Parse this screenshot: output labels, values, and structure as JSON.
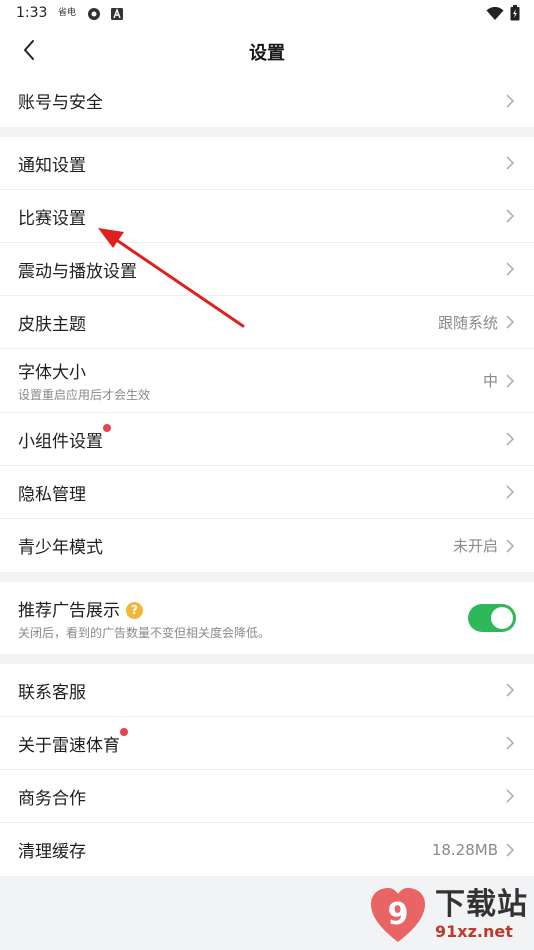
{
  "status_bar": {
    "time": "1:33",
    "small_icon_text": "省电"
  },
  "header": {
    "title": "设置"
  },
  "groups": [
    {
      "items": [
        {
          "label": "账号与安全",
          "value": ""
        }
      ]
    },
    {
      "items": [
        {
          "label": "通知设置",
          "value": ""
        },
        {
          "label": "比赛设置",
          "value": ""
        },
        {
          "label": "震动与播放设置",
          "value": ""
        },
        {
          "label": "皮肤主题",
          "value": "跟随系统"
        },
        {
          "label": "字体大小",
          "subtitle": "设置重启应用后才会生效",
          "value": "中"
        },
        {
          "label": "小组件设置",
          "value": "",
          "badge": true
        },
        {
          "label": "隐私管理",
          "value": ""
        },
        {
          "label": "青少年模式",
          "value": "未开启"
        }
      ]
    },
    {
      "items": [
        {
          "label": "推荐广告展示",
          "subtitle": "关闭后，看到的广告数量不变但相关度会降低。",
          "help_icon": "?",
          "toggle_on": true
        }
      ]
    },
    {
      "items": [
        {
          "label": "联系客服",
          "value": ""
        },
        {
          "label": "关于雷速体育",
          "value": "",
          "badge": true
        },
        {
          "label": "商务合作",
          "value": ""
        },
        {
          "label": "清理缓存",
          "value": "18.28MB"
        }
      ]
    }
  ],
  "watermark": {
    "text": "下载站",
    "url": "91xz.net",
    "logo_text": "9"
  },
  "colors": {
    "accent_green": "#2fb85a",
    "badge_red": "#e8424f",
    "help_yellow": "#f5b43a",
    "annotation_red": "#e02020"
  }
}
